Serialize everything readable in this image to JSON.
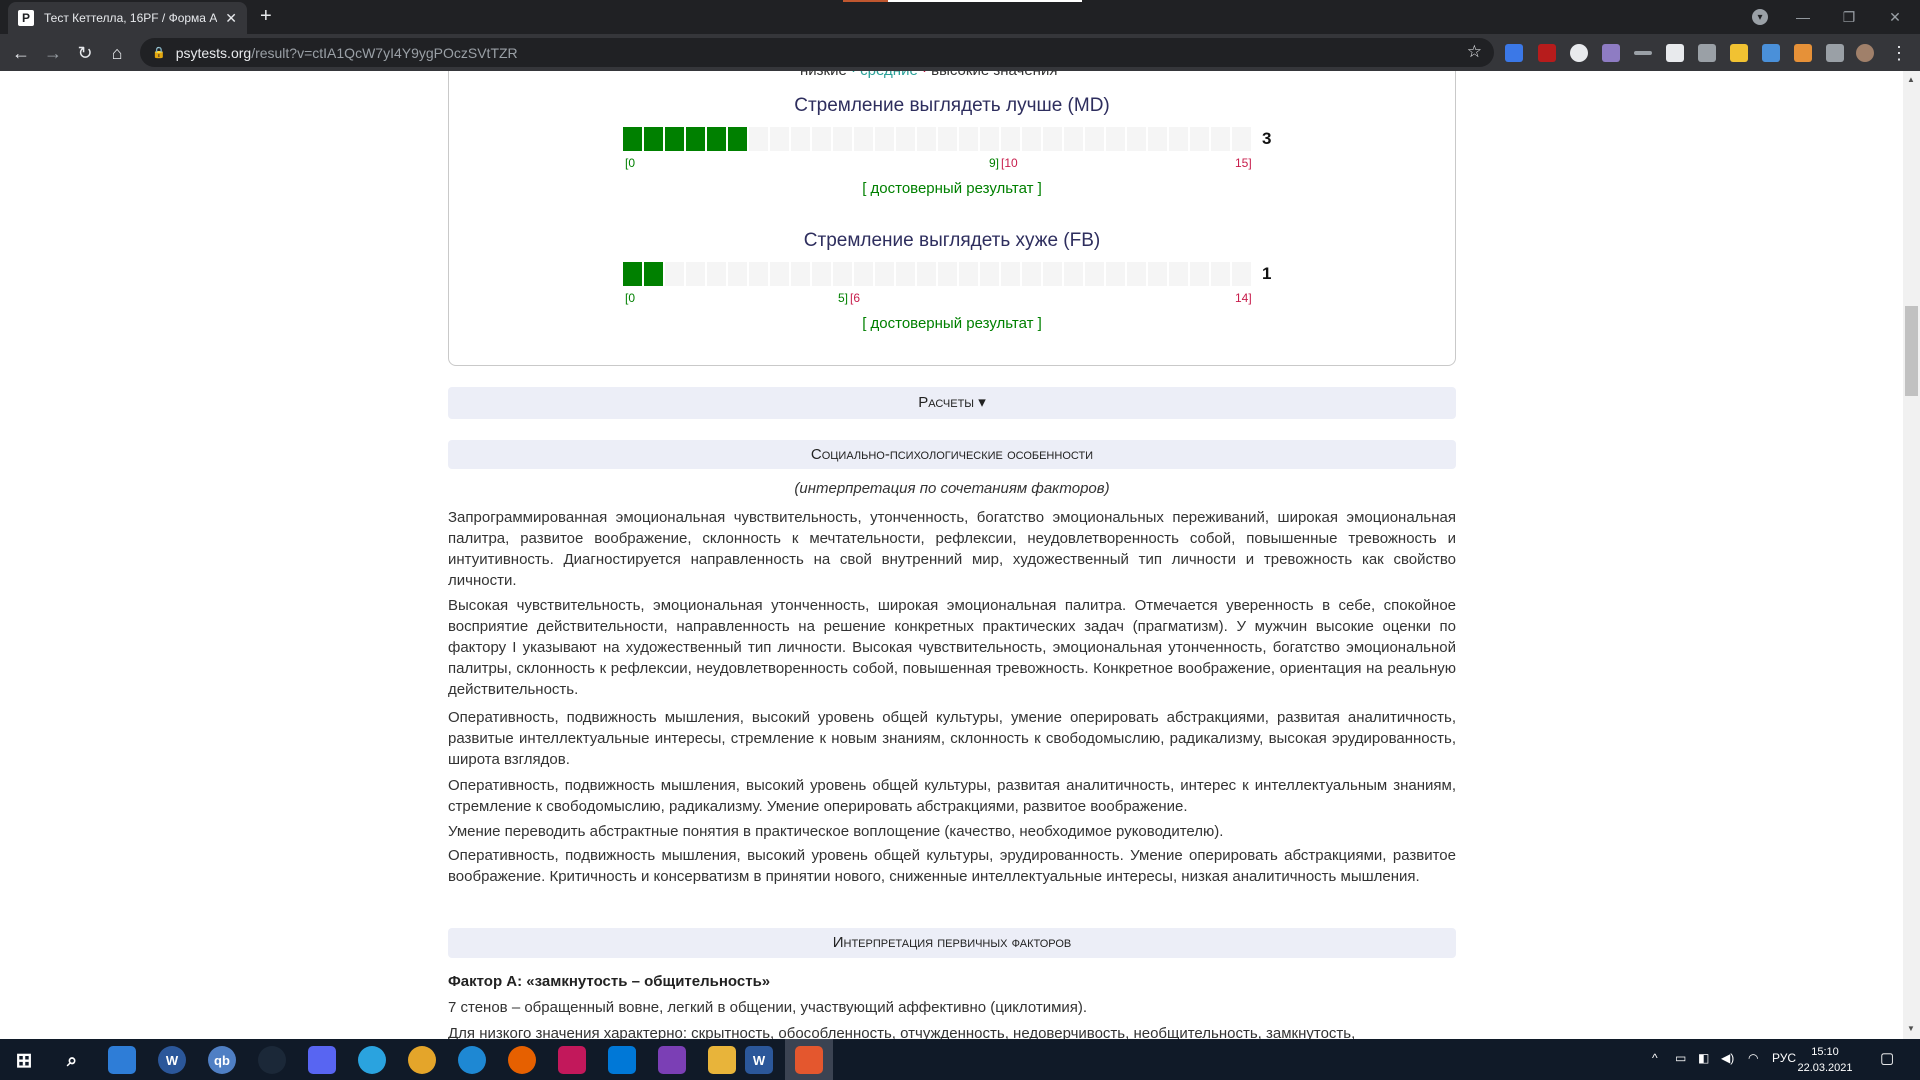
{
  "browser": {
    "tab_title": "Тест Кеттелла, 16PF / Форма А. |",
    "tab_favicon": "P",
    "url_domain": "psytests.org",
    "url_path": "/result?v=ctIA1QcW7yI4Y9ygPOczSVtTZR"
  },
  "legend_cut": {
    "low": "низкие",
    "mid": "средние",
    "high": "высокие значения"
  },
  "scales": [
    {
      "title": "Стремление выглядеть лучше (MD)",
      "score": "3",
      "filled_segments": 6,
      "total_segments": 30,
      "tick_min": "[0",
      "tick_mid_left": "9]",
      "tick_mid_right": "[10",
      "tick_max": "15]",
      "verdict": "[ достоверный результат ]"
    },
    {
      "title": "Стремление выглядеть хуже (FB)",
      "score": "1",
      "filled_segments": 2,
      "total_segments": 30,
      "tick_min": "[0",
      "tick_mid_left": "5]",
      "tick_mid_right": "[6",
      "tick_max": "14]",
      "verdict": "[ достоверный результат ]"
    }
  ],
  "sections": {
    "calc": "Расчеты ▾",
    "social": "Социально-психологические особенности",
    "social_subtitle": "(интерпретация по сочетаниям факторов)",
    "primary": "Интерпретация первичных факторов"
  },
  "paragraphs": [
    "Запрограммированная эмоциональная чувствительность, утонченность, богатство эмоциональных переживаний, широкая эмоциональная палитра, развитое воображение, склонность к мечтательности, рефлексии, неудовлетворенность собой, повышенные тревожность и интуитивность. Диагностируется направленность на свой внутренний мир, художественный тип личности и тревожность как свойство личности.",
    "Высокая чувствительность, эмоциональная утонченность, широкая эмоциональная палитра. Отмечается уверенность в себе, спокойное восприятие действительности, направленность на решение конкретных практических задач (прагматизм). У мужчин высокие оценки по фактору I указывают на художественный тип личности. Высокая чувствительность, эмоциональная утонченность, богатство эмоциональной палитры, склонность к рефлексии, неудовлетворенность собой, повышенная тревожность. Конкретное воображение, ориентация на реальную действительность.",
    "Оперативность, подвижность мышления, высокий уровень общей культуры, умение оперировать абстракциями, развитая аналитичность, развитые интеллектуальные интересы, стремление к новым знаниям, склонность к свободомыслию, радикализму, высокая эрудированность, широта взглядов.",
    "Оперативность, подвижность мышления, высокий уровень общей культуры, развитая аналитичность, интерес к интеллектуальным знаниям, стремление к свободомыслию, радикализму. Умение оперировать абстракциями, развитое воображение.",
    "Умение переводить абстрактные понятия в практическое воплощение (качество, необходимое руководителю).",
    "Оперативность, подвижность мышления, высокий уровень общей культуры, эрудированность. Умение оперировать абстракциями, развитое воображение. Критичность и консерватизм в принятии нового, сниженные интеллектуальные интересы, низкая аналитичность мышления."
  ],
  "factor_a": {
    "title": "Фактор А: «замкнутость – общительность»",
    "line1": "7 стенов – обращенный вовне, легкий в общении, участвующий аффективно (циклотимия).",
    "line2": "Для низкого значения характерно: скрытность, обособленность, отчужденность, недоверчивость, необщительность, замкнутость,"
  },
  "taskbar": {
    "language": "РУС",
    "time": "15:10",
    "date": "22.03.2021"
  },
  "colors": {
    "filled": "#008000",
    "empty": "#f5f5f5",
    "valid_text": "#008000",
    "tick_high": "#c71c4b",
    "section_bg": "#eceef7",
    "title_text": "#2e2e5e"
  }
}
